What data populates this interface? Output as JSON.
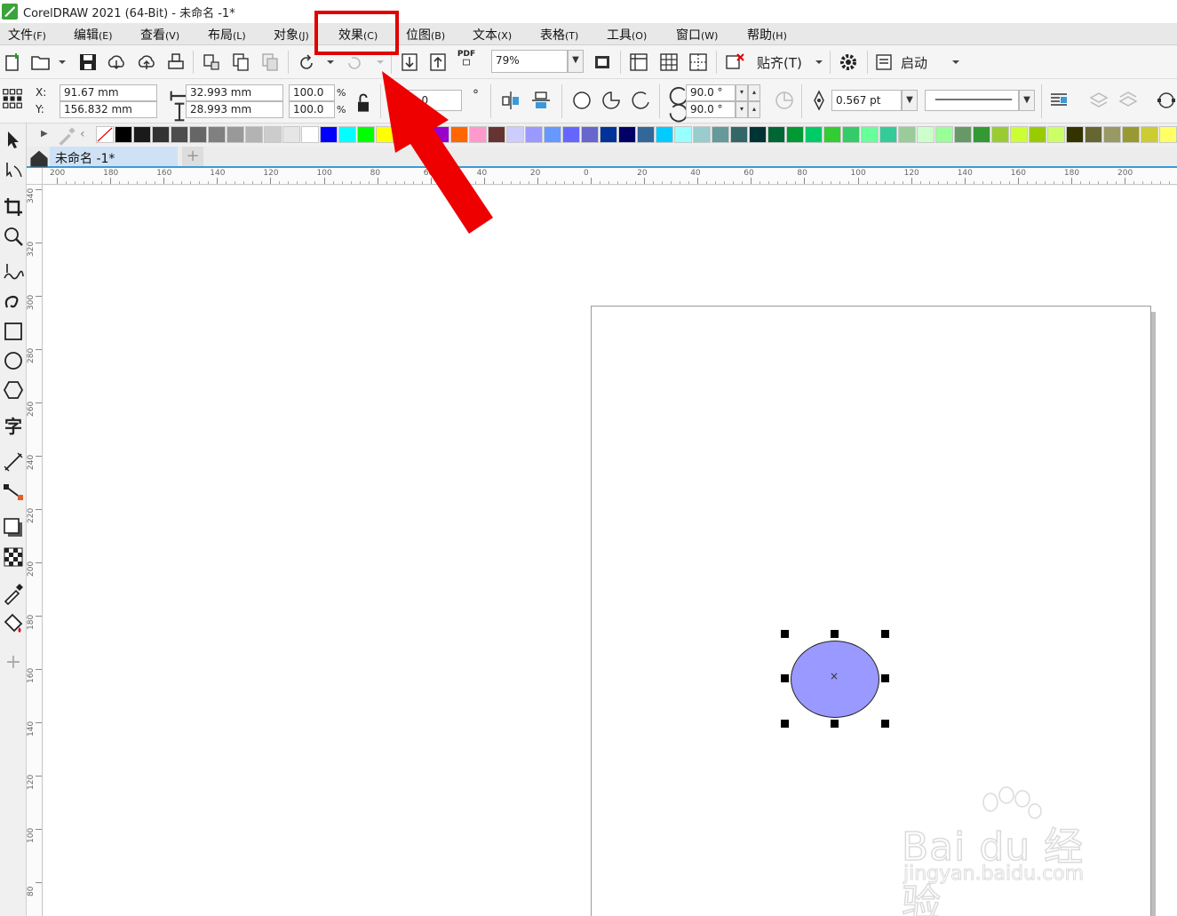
{
  "window": {
    "title": "CorelDRAW 2021 (64-Bit) - 未命名 -1*"
  },
  "menu": [
    {
      "label": "文件",
      "accel": "(F)"
    },
    {
      "label": "编辑",
      "accel": "(E)"
    },
    {
      "label": "查看",
      "accel": "(V)"
    },
    {
      "label": "布局",
      "accel": "(L)"
    },
    {
      "label": "对象",
      "accel": "(J)"
    },
    {
      "label": "效果",
      "accel": "(C)"
    },
    {
      "label": "位图",
      "accel": "(B)"
    },
    {
      "label": "文本",
      "accel": "(X)"
    },
    {
      "label": "表格",
      "accel": "(T)"
    },
    {
      "label": "工具",
      "accel": "(O)"
    },
    {
      "label": "窗口",
      "accel": "(W)"
    },
    {
      "label": "帮助",
      "accel": "(H)"
    }
  ],
  "toolbar": {
    "zoom": "79%",
    "snap_label": "贴齐(T)",
    "launch_label": "启动",
    "pdf_label": "PDF"
  },
  "properties": {
    "x_label": "X:",
    "y_label": "Y:",
    "x_value": "91.67 mm",
    "y_value": "156.832 mm",
    "width": "32.993 mm",
    "height": "28.993 mm",
    "scale_w": "100.0",
    "scale_h": "100.0",
    "pct": "%",
    "rotation": "0.0",
    "rotation_unit": "°",
    "start_angle": "90.0 °",
    "end_angle": "90.0 °",
    "outline_width": "0.567 pt"
  },
  "palette": [
    "#ffffff",
    "#000000",
    "#1a1a1a",
    "#333333",
    "#4d4d4d",
    "#666666",
    "#808080",
    "#999999",
    "#b3b3b3",
    "#cccccc",
    "#e6e6e6",
    "#ffffff",
    "#0000ff",
    "#00ffff",
    "#00ff00",
    "#ffff00",
    "#ff0000",
    "#ff00ff",
    "#9900cc",
    "#ff6600",
    "#ff99cc",
    "#663333",
    "#ccccff",
    "#9999ff",
    "#6699ff",
    "#6666ff",
    "#6666cc",
    "#003399",
    "#000066",
    "#336699",
    "#00ccff",
    "#99ffff",
    "#99cccc",
    "#669999",
    "#336666",
    "#003333",
    "#006633",
    "#009933",
    "#00cc66",
    "#33cc33",
    "#33cc66",
    "#66ff99",
    "#33cc99",
    "#99cc99",
    "#ccffcc",
    "#99ff99",
    "#669966",
    "#339933",
    "#99cc33",
    "#ccff33",
    "#99cc00",
    "#ccff66",
    "#333300",
    "#666633",
    "#999966",
    "#999933",
    "#cccc33",
    "#ffff66"
  ],
  "document_tab": {
    "label": "未命名 -1*"
  },
  "hruler_labels": [
    "200",
    "180",
    "160",
    "140",
    "120",
    "100",
    "80",
    "60",
    "40",
    "20",
    "0",
    "20",
    "40",
    "60",
    "80",
    "100",
    "120",
    "140",
    "160",
    "180",
    "200"
  ],
  "vruler_labels": [
    "340",
    "320",
    "300",
    "280",
    "260",
    "240",
    "220",
    "200",
    "180",
    "160",
    "140",
    "120",
    "100",
    "80"
  ],
  "canvas": {
    "center_mark": "×"
  },
  "watermark": {
    "line1": "Bai du 经验",
    "line2": "jingyan.baidu.com"
  }
}
